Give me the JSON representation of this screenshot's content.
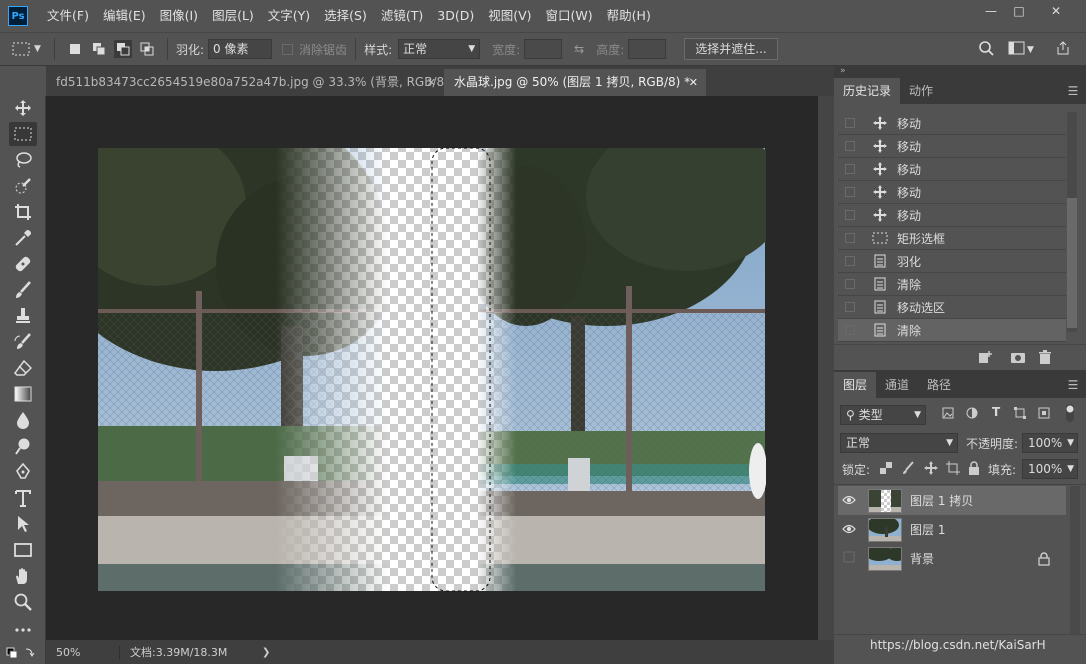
{
  "app": {
    "logo": "Ps"
  },
  "menu": [
    "文件(F)",
    "编辑(E)",
    "图像(I)",
    "图层(L)",
    "文字(Y)",
    "选择(S)",
    "滤镜(T)",
    "3D(D)",
    "视图(V)",
    "窗口(W)",
    "帮助(H)"
  ],
  "options": {
    "feather_label": "羽化:",
    "feather_value": "0 像素",
    "antialias_label": "消除锯齿",
    "style_label": "样式:",
    "style_value": "正常",
    "width_label": "宽度:",
    "height_label": "高度:",
    "select_mask_button": "选择并遮住..."
  },
  "tabs": [
    {
      "label": "fd511b83473cc2654519e80a752a47b.jpg @ 33.3% (背景, RGB/8) *",
      "active": false
    },
    {
      "label": "水晶球.jpg @ 50% (图层 1 拷贝, RGB/8) *",
      "active": true
    }
  ],
  "status": {
    "zoom": "50%",
    "doc": "文档:3.39M/18.3M"
  },
  "history_panel": {
    "tabs": [
      "历史记录",
      "动作"
    ],
    "items": [
      {
        "label": "移动",
        "icon": "move-icon"
      },
      {
        "label": "移动",
        "icon": "move-icon"
      },
      {
        "label": "移动",
        "icon": "move-icon"
      },
      {
        "label": "移动",
        "icon": "move-icon"
      },
      {
        "label": "移动",
        "icon": "move-icon"
      },
      {
        "label": "矩形选框",
        "icon": "marquee-icon"
      },
      {
        "label": "羽化",
        "icon": "document-icon"
      },
      {
        "label": "清除",
        "icon": "document-icon"
      },
      {
        "label": "移动选区",
        "icon": "document-icon"
      },
      {
        "label": "清除",
        "icon": "document-icon"
      }
    ]
  },
  "layers_panel": {
    "tabs": [
      "图层",
      "通道",
      "路径"
    ],
    "filter_label": "类型",
    "blend_mode": "正常",
    "opacity_label": "不透明度:",
    "opacity_value": "100%",
    "lock_label": "锁定:",
    "fill_label": "填充:",
    "fill_value": "100%",
    "layers": [
      {
        "name": "图层 1 拷贝",
        "visible": true,
        "selected": true
      },
      {
        "name": "图层 1",
        "visible": true,
        "selected": false
      },
      {
        "name": "背景",
        "visible": false,
        "selected": false,
        "locked": true
      }
    ]
  },
  "watermark": "https://blog.csdn.net/KaiSarH"
}
